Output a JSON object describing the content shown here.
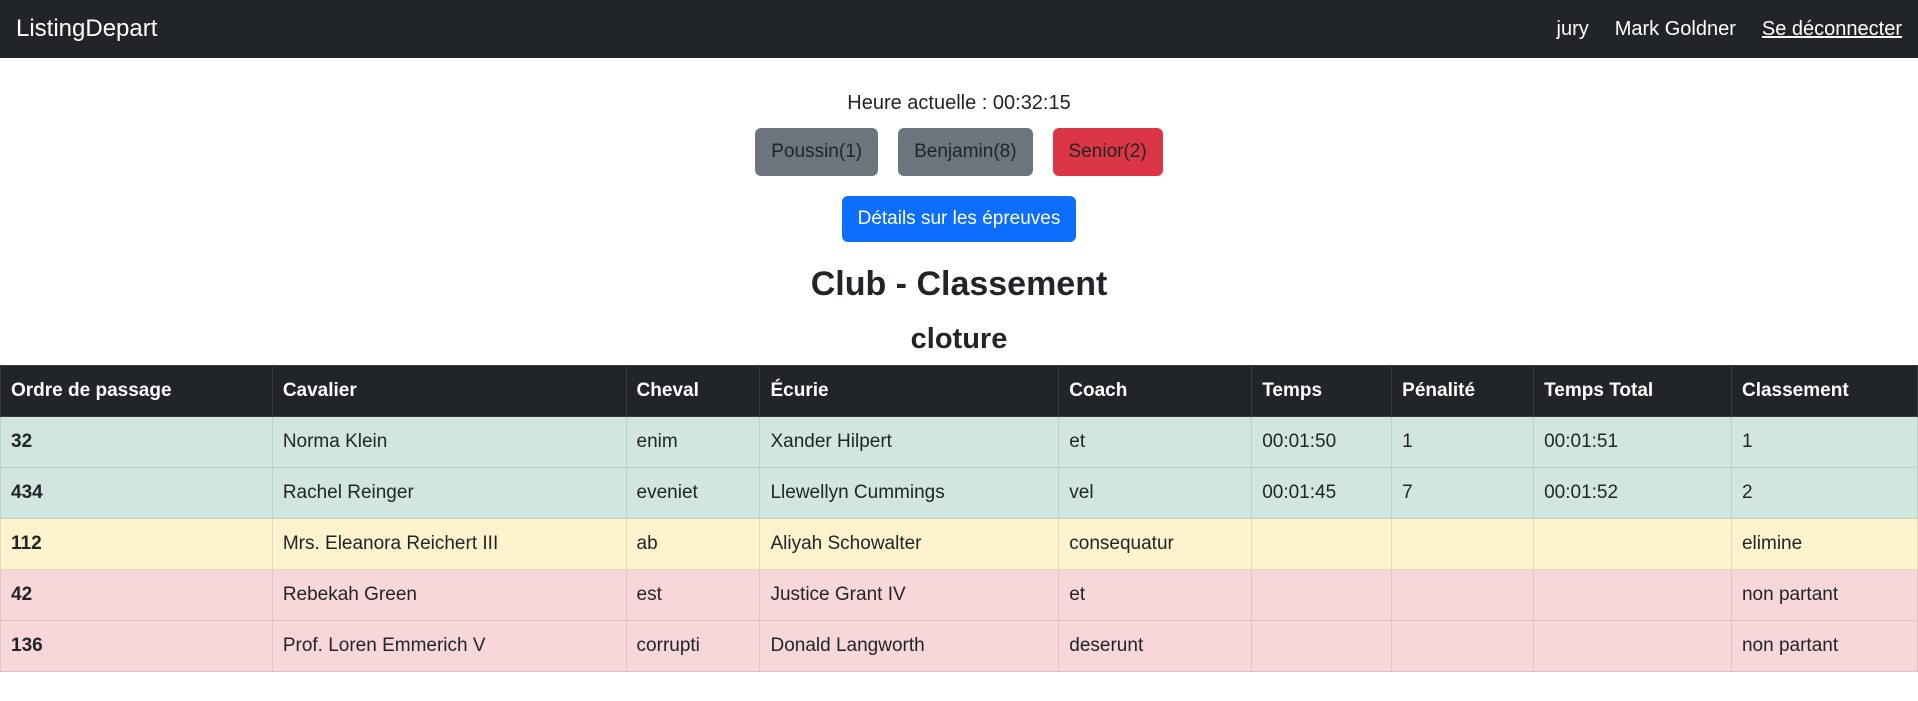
{
  "navbar": {
    "brand": "ListingDepart",
    "role": "jury",
    "user": "Mark Goldner",
    "logout": "Se déconnecter"
  },
  "time_text": "Heure actuelle : 00:32:15",
  "categories": [
    {
      "label": "Poussin(1)",
      "color": "#6c757d"
    },
    {
      "label": "Benjamin(8)",
      "color": "#6c757d"
    },
    {
      "label": "Senior(2)",
      "color": "#dc3545"
    }
  ],
  "details_button": "Détails sur les épreuves",
  "title": "Club - Classement",
  "subtitle": "cloture",
  "table": {
    "headers": [
      "Ordre de passage",
      "Cavalier",
      "Cheval",
      "Écurie",
      "Coach",
      "Temps",
      "Pénalité",
      "Temps Total",
      "Classement"
    ],
    "rows": [
      {
        "status": "success",
        "cells": [
          "32",
          "Norma Klein",
          "enim",
          "Xander Hilpert",
          "et",
          "00:01:50",
          "1",
          "00:01:51",
          "1"
        ]
      },
      {
        "status": "success",
        "cells": [
          "434",
          "Rachel Reinger",
          "eveniet",
          "Llewellyn Cummings",
          "vel",
          "00:01:45",
          "7",
          "00:01:52",
          "2"
        ]
      },
      {
        "status": "warning",
        "cells": [
          "112",
          "Mrs. Eleanora Reichert III",
          "ab",
          "Aliyah Schowalter",
          "consequatur",
          "",
          "",
          "",
          "elimine"
        ]
      },
      {
        "status": "danger",
        "cells": [
          "42",
          "Rebekah Green",
          "est",
          "Justice Grant IV",
          "et",
          "",
          "",
          "",
          "non partant"
        ]
      },
      {
        "status": "danger",
        "cells": [
          "136",
          "Prof. Loren Emmerich V",
          "corrupti",
          "Donald Langworth",
          "deserunt",
          "",
          "",
          "",
          "non partant"
        ]
      }
    ]
  },
  "colors": {
    "navbar_bg": "#212529",
    "primary": "#0d6efd",
    "success_row": "#d1e7dd",
    "warning_row": "#fff3cd",
    "danger_row": "#f8d7da"
  }
}
